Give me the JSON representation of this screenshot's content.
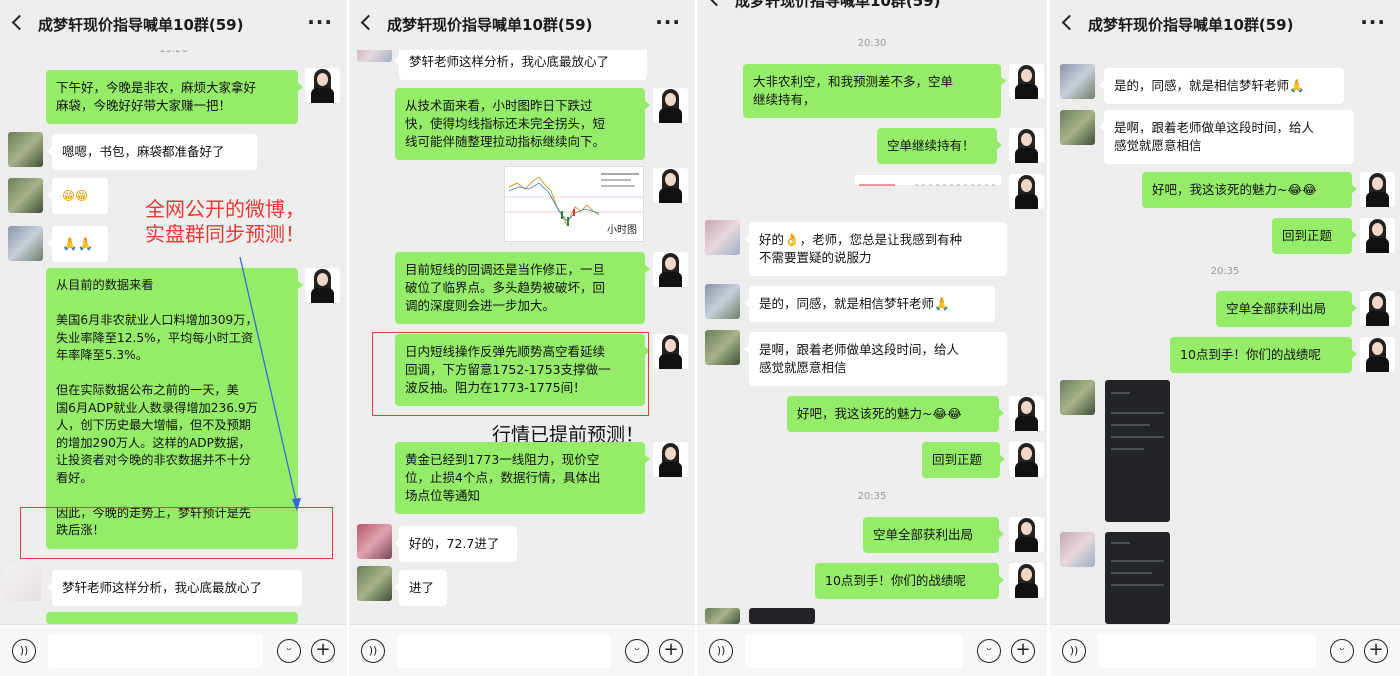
{
  "app": {
    "title": "成梦轩现价指导喊单10群(59)"
  },
  "annotations": {
    "red_note": "全网公开的微博，\n实盘群同步预测！",
    "black_note": "行情已提前预测！"
  },
  "panel1": {
    "time": "15:20",
    "m1": "下午好，今晚是非农，麻烦大家拿好\n麻袋，今晚好好带大家赚一把！",
    "m2": "嗯嗯，书包，麻袋都准备好了",
    "m3": "😁😁",
    "m4": "🙏🙏",
    "m5": "从目前的数据来看\n\n美国6月非农就业人口料增加309万，\n失业率降至12.5%，平均每小时工资\n年率降至5.3%。\n\n但在实际数据公布之前的一天，美\n国6月ADP就业人数录得增加236.9万\n人，创下历史最大增幅，但不及预期\n的增加290万人。这样的ADP数据，\n让投资者对今晚的非农数据并不十分\n看好。\n\n因此，今晚的走势上，梦轩预计是先\n跌后涨！",
    "m6": "梦轩老师这样分析，我心底最放心了"
  },
  "panel2": {
    "m1": "梦轩老师这样分析，我心底最放心了",
    "m2": "从技术面来看，小时图昨日下跌过\n快，使得均线指标还未完全拐头，短\n线可能伴随整理拉动指标继续向下。",
    "chart_caption": "小时图",
    "m3": "目前短线的回调还是当作修正，一旦\n破位了临界点。多头趋势被破坏，回\n调的深度则会进一步加大。",
    "m4": "日内短线操作反弹先顺势高空看延续\n回调，下方留意1752-1753支撑做一\n波反抽。阻力在1773-1775间！",
    "m5": "黄金已经到1773一线阻力，现价空\n位，止损4个点，数据行情，具体出\n场点位等通知",
    "m6": "好的，72.7进了",
    "m7": "进了"
  },
  "panel3": {
    "time1": "20:30",
    "m1": "大非农利空，和我预测差不多，空单\n继续持有，",
    "m2": "空单继续持有！",
    "m3": "好的👌，老师，您总是让我感到有种\n不需要置疑的说服力",
    "m4": "是的，同感，就是相信梦轩老师🙏",
    "m5": "是啊，跟着老师做单这段时间，给人\n感觉就愿意相信",
    "m6": "好吧，我这该死的魅力~😂😂",
    "m7": "回到正题",
    "time2": "20:35",
    "m8": "空单全部获利出局",
    "m9": "10点到手！你们的战绩呢"
  },
  "panel4": {
    "m1": "是的，同感，就是相信梦轩老师🙏",
    "m2": "是啊，跟着老师做单这段时间，给人\n感觉就愿意相信",
    "m3": "好吧，我这该死的魅力~😂😂",
    "m4": "回到正题",
    "time": "20:35",
    "m5": "空单全部获利出局",
    "m6": "10点到手！你们的战绩呢"
  }
}
